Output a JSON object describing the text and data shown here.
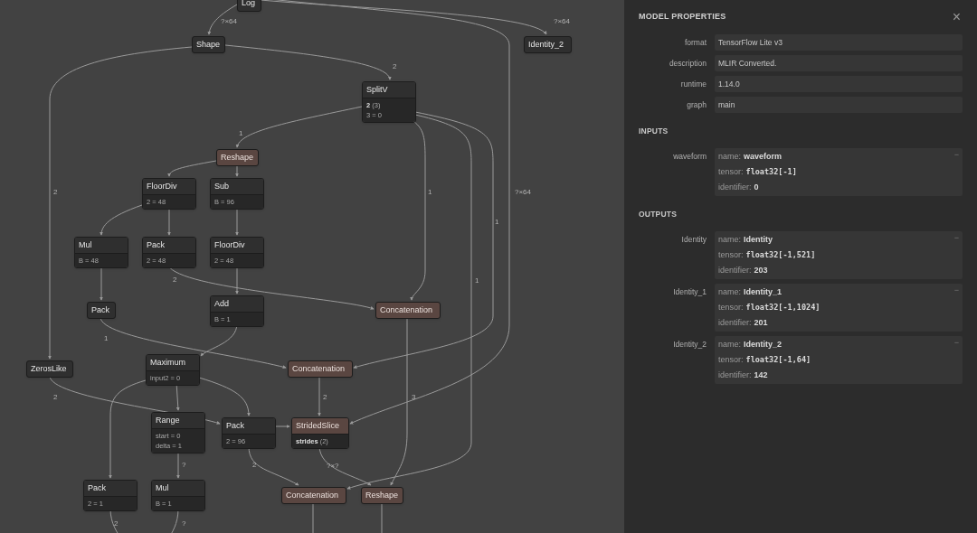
{
  "graph": {
    "nodes": [
      {
        "name": "Log",
        "kind": "plain"
      },
      {
        "name": "Shape",
        "kind": "plain"
      },
      {
        "name": "Identity_2",
        "kind": "plain"
      },
      {
        "name": "SplitV",
        "kind": "plain",
        "attributes": [
          "**2** (3)",
          "3 = 0"
        ]
      },
      {
        "name": "Reshape",
        "kind": "shape"
      },
      {
        "name": "FloorDiv",
        "kind": "plain",
        "attributes": [
          "2 = 48"
        ]
      },
      {
        "name": "Sub",
        "kind": "plain",
        "attributes": [
          "B = 96"
        ]
      },
      {
        "name": "Mul",
        "kind": "plain",
        "attributes": [
          "B = 48"
        ]
      },
      {
        "name": "Pack",
        "kind": "plain",
        "attributes": [
          "2 = 48"
        ]
      },
      {
        "name": "FloorDiv",
        "kind": "plain",
        "attributes": [
          "2 = 48"
        ]
      },
      {
        "name": "Pack",
        "kind": "plain"
      },
      {
        "name": "Add",
        "kind": "plain",
        "attributes": [
          "B = 1"
        ]
      },
      {
        "name": "Concatenation",
        "kind": "shape"
      },
      {
        "name": "ZerosLike",
        "kind": "plain"
      },
      {
        "name": "Maximum",
        "kind": "plain",
        "attributes": [
          "input2 = 0"
        ]
      },
      {
        "name": "Concatenation",
        "kind": "shape"
      },
      {
        "name": "Range",
        "kind": "plain",
        "attributes": [
          "start = 0",
          "delta = 1"
        ]
      },
      {
        "name": "Pack",
        "kind": "plain",
        "attributes": [
          "2 = 96"
        ]
      },
      {
        "name": "StridedSlice",
        "kind": "shape",
        "attributes": [
          "**strides** (2)"
        ]
      },
      {
        "name": "Pack",
        "kind": "plain",
        "attributes": [
          "2 = 1"
        ]
      },
      {
        "name": "Mul",
        "kind": "plain",
        "attributes": [
          "B = 1"
        ]
      },
      {
        "name": "Concatenation",
        "kind": "shape"
      },
      {
        "name": "Reshape",
        "kind": "shape"
      }
    ],
    "edges": [
      {
        "label": "?×64"
      },
      {
        "label": "?×64"
      },
      {
        "label": "2"
      },
      {
        "label": "1"
      },
      {
        "label": "2"
      },
      {
        "label": "1"
      },
      {
        "label": "?×64"
      },
      {
        "label": "1"
      },
      {
        "label": "2"
      },
      {
        "label": "1"
      },
      {
        "label": "1"
      },
      {
        "label": "2"
      },
      {
        "label": "2"
      },
      {
        "label": "3"
      },
      {
        "label": "?"
      },
      {
        "label": "2"
      },
      {
        "label": "?×?"
      },
      {
        "label": "2"
      },
      {
        "label": "?"
      }
    ]
  },
  "panel": {
    "title": "MODEL PROPERTIES",
    "close": "×",
    "properties": [
      {
        "label": "format",
        "value": "TensorFlow Lite v3"
      },
      {
        "label": "description",
        "value": "MLIR Converted."
      },
      {
        "label": "runtime",
        "value": "1.14.0"
      },
      {
        "label": "graph",
        "value": "main"
      }
    ],
    "sections": [
      {
        "title": "INPUTS",
        "items": [
          {
            "label": "waveform",
            "toggle": "−",
            "lines": [
              {
                "key": "name:",
                "value": "waveform",
                "kind": "text"
              },
              {
                "key": "tensor:",
                "value": "float32[-1]",
                "kind": "code"
              },
              {
                "key": "identifier:",
                "value": "0",
                "kind": "text"
              }
            ]
          }
        ]
      },
      {
        "title": "OUTPUTS",
        "items": [
          {
            "label": "Identity",
            "toggle": "−",
            "lines": [
              {
                "key": "name:",
                "value": "Identity",
                "kind": "text"
              },
              {
                "key": "tensor:",
                "value": "float32[-1,521]",
                "kind": "code"
              },
              {
                "key": "identifier:",
                "value": "203",
                "kind": "text"
              }
            ]
          },
          {
            "label": "Identity_1",
            "toggle": "−",
            "lines": [
              {
                "key": "name:",
                "value": "Identity_1",
                "kind": "text"
              },
              {
                "key": "tensor:",
                "value": "float32[-1,1024]",
                "kind": "code"
              },
              {
                "key": "identifier:",
                "value": "201",
                "kind": "text"
              }
            ]
          },
          {
            "label": "Identity_2",
            "toggle": "−",
            "lines": [
              {
                "key": "name:",
                "value": "Identity_2",
                "kind": "text"
              },
              {
                "key": "tensor:",
                "value": "float32[-1,64]",
                "kind": "code"
              },
              {
                "key": "identifier:",
                "value": "142",
                "kind": "text"
              }
            ]
          }
        ]
      }
    ]
  }
}
